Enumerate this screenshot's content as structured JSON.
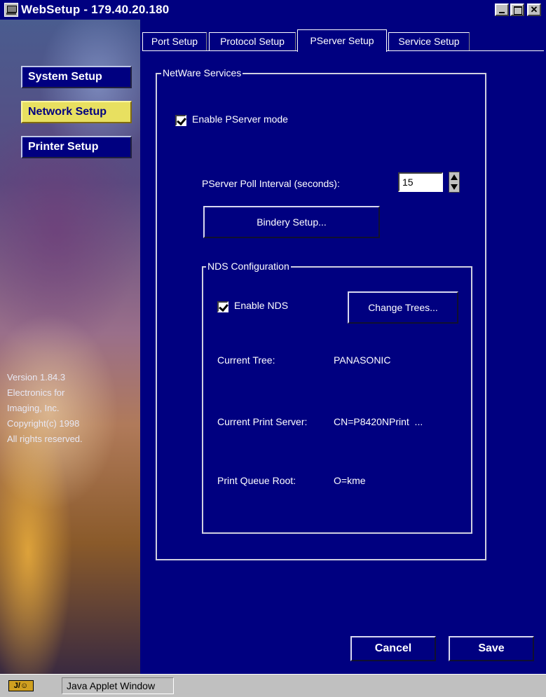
{
  "window": {
    "title": "WebSetup - 179.40.20.180",
    "min_glyph": "_",
    "max_glyph": "□",
    "close_glyph": "✕"
  },
  "sidebar": {
    "items": [
      {
        "label": "System Setup",
        "active": false
      },
      {
        "label": "Network Setup",
        "active": true
      },
      {
        "label": "Printer Setup",
        "active": false
      }
    ],
    "version_lines": [
      "Version 1.84.3",
      "Electronics for",
      "Imaging, Inc.",
      "Copyright(c) 1998",
      "All rights reserved."
    ]
  },
  "tabs": [
    {
      "label": "Port Setup",
      "active": false
    },
    {
      "label": "Protocol Setup",
      "active": false
    },
    {
      "label": "PServer Setup",
      "active": true
    },
    {
      "label": "Service Setup",
      "active": false
    }
  ],
  "netware": {
    "group_label": "NetWare Services",
    "enable_pserver_label": "Enable PServer mode",
    "enable_pserver_checked": true,
    "poll_interval_label": "PServer Poll Interval (seconds):",
    "poll_interval_value": "15",
    "bindery_button": "Bindery Setup..."
  },
  "nds": {
    "group_label": "NDS Configuration",
    "enable_nds_label": "Enable NDS",
    "enable_nds_checked": true,
    "change_trees_button": "Change Trees...",
    "current_tree_label": "Current Tree:",
    "current_tree_value": "PANASONIC",
    "print_server_label": "Current Print Server:",
    "print_server_value": "CN=P8420NPrint  ...",
    "queue_root_label": "Print Queue Root:",
    "queue_root_value": "O=kme"
  },
  "footer": {
    "cancel_label": "Cancel",
    "save_label": "Save"
  },
  "statusbar": {
    "icon_text": "J/☺",
    "text": "Java Applet Window"
  },
  "colors": {
    "panel_bg": "#000080",
    "active_sidebar": "#e8e060",
    "titlebar": "#000080"
  }
}
